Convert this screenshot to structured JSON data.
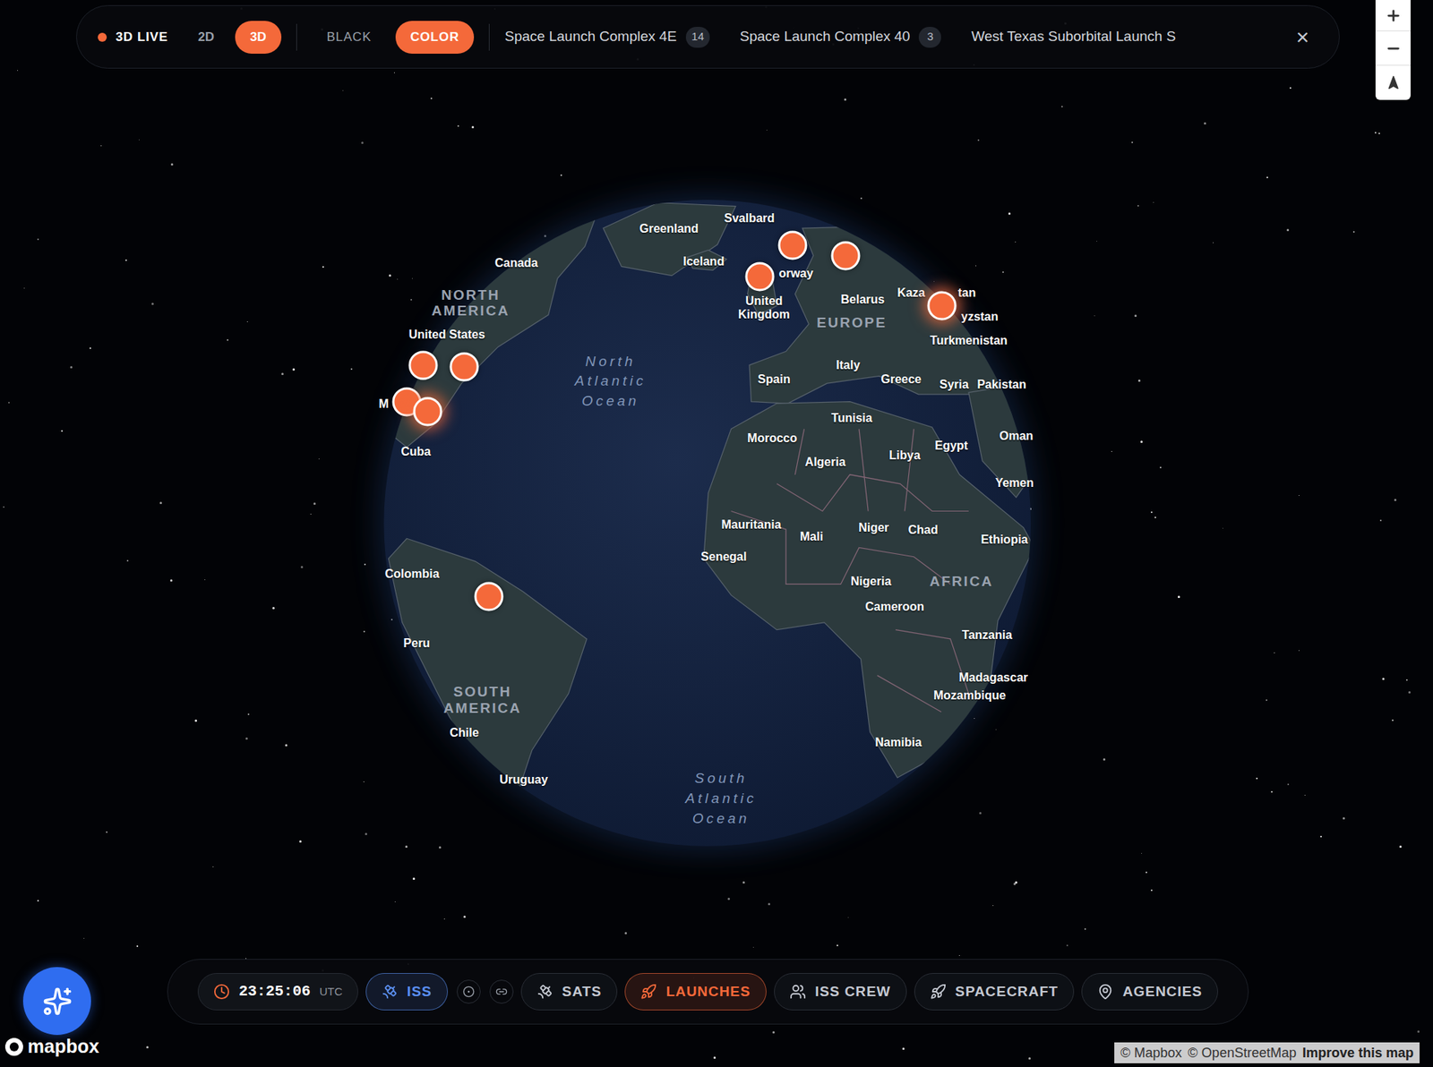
{
  "topbar": {
    "live": "3D LIVE",
    "views": [
      {
        "label": "2D",
        "selected": false
      },
      {
        "label": "3D",
        "selected": true
      }
    ],
    "styles": [
      {
        "label": "BLACK",
        "selected": false
      },
      {
        "label": "COLOR",
        "selected": true
      }
    ],
    "sites": [
      {
        "label": "Space Launch Complex 4E",
        "count": "14"
      },
      {
        "label": "Space Launch Complex 40",
        "count": "3"
      },
      {
        "label": "West Texas Suborbital Launch S"
      }
    ],
    "close": "×"
  },
  "zoom": {
    "in": "+",
    "out": "−"
  },
  "map": {
    "labels": [
      {
        "text": "Svalbard",
        "kind": "country"
      },
      {
        "text": "Greenland",
        "kind": "country"
      },
      {
        "text": "Canada",
        "kind": "country"
      },
      {
        "text": "Iceland",
        "kind": "country"
      },
      {
        "text": "orway",
        "kind": "country"
      },
      {
        "text": "NORTH AMERICA",
        "kind": "region"
      },
      {
        "text": "United Kingdom",
        "kind": "country"
      },
      {
        "text": "Belarus",
        "kind": "country"
      },
      {
        "text": "Kaza",
        "kind": "country"
      },
      {
        "text": "tan",
        "kind": "country"
      },
      {
        "text": "yzstan",
        "kind": "country"
      },
      {
        "text": "EUROPE",
        "kind": "region"
      },
      {
        "text": "United States",
        "kind": "country"
      },
      {
        "text": "Turkmenistan",
        "kind": "country"
      },
      {
        "text": "North Atlantic Ocean",
        "kind": "ocean"
      },
      {
        "text": "Italy",
        "kind": "country"
      },
      {
        "text": "Spain",
        "kind": "country"
      },
      {
        "text": "Greece",
        "kind": "country"
      },
      {
        "text": "Syria",
        "kind": "country"
      },
      {
        "text": "Pakistan",
        "kind": "country"
      },
      {
        "text": "M",
        "kind": "country"
      },
      {
        "text": "Tunisia",
        "kind": "country"
      },
      {
        "text": "Morocco",
        "kind": "country"
      },
      {
        "text": "Oman",
        "kind": "country"
      },
      {
        "text": "Egypt",
        "kind": "country"
      },
      {
        "text": "Cuba",
        "kind": "country"
      },
      {
        "text": "Libya",
        "kind": "country"
      },
      {
        "text": "Algeria",
        "kind": "country"
      },
      {
        "text": "Yemen",
        "kind": "country"
      },
      {
        "text": "Mauritania",
        "kind": "country"
      },
      {
        "text": "Niger",
        "kind": "country"
      },
      {
        "text": "Chad",
        "kind": "country"
      },
      {
        "text": "Mali",
        "kind": "country"
      },
      {
        "text": "Ethiopia",
        "kind": "country"
      },
      {
        "text": "Senegal",
        "kind": "country"
      },
      {
        "text": "Colombia",
        "kind": "country"
      },
      {
        "text": "Nigeria",
        "kind": "country"
      },
      {
        "text": "AFRICA",
        "kind": "region"
      },
      {
        "text": "Cameroon",
        "kind": "country"
      },
      {
        "text": "Tanzania",
        "kind": "country"
      },
      {
        "text": "Peru",
        "kind": "country"
      },
      {
        "text": "Madagascar",
        "kind": "country"
      },
      {
        "text": "Mozambique",
        "kind": "country"
      },
      {
        "text": "SOUTH AMERICA",
        "kind": "region"
      },
      {
        "text": "Chile",
        "kind": "country"
      },
      {
        "text": "Namibia",
        "kind": "country"
      },
      {
        "text": "Uruguay",
        "kind": "country"
      },
      {
        "text": "South Atlantic Ocean",
        "kind": "ocean"
      }
    ],
    "pins": [
      {
        "glow": false
      },
      {
        "glow": false
      },
      {
        "glow": false
      },
      {
        "glow": true
      },
      {
        "glow": false
      },
      {
        "glow": false
      },
      {
        "glow": false
      },
      {
        "glow": true
      },
      {
        "glow": false
      }
    ]
  },
  "bottombar": {
    "clock": {
      "time": "23:25:06",
      "zone": "UTC"
    },
    "items": [
      {
        "label": "ISS",
        "selected": true,
        "color": "#5b8ff0"
      },
      {
        "label": "SATS",
        "selected": false,
        "color": "#c5c9d2"
      },
      {
        "label": "LAUNCHES",
        "selected": true,
        "color": "#f4693a"
      },
      {
        "label": "ISS CREW",
        "selected": false,
        "color": "#c5c9d2"
      },
      {
        "label": "SPACECRAFT",
        "selected": false,
        "color": "#c5c9d2"
      },
      {
        "label": "AGENCIES",
        "selected": false,
        "color": "#c5c9d2"
      }
    ]
  },
  "logo": "mapbox",
  "attribution": [
    "© Mapbox",
    "© OpenStreetMap"
  ],
  "improve": "Improve this map"
}
